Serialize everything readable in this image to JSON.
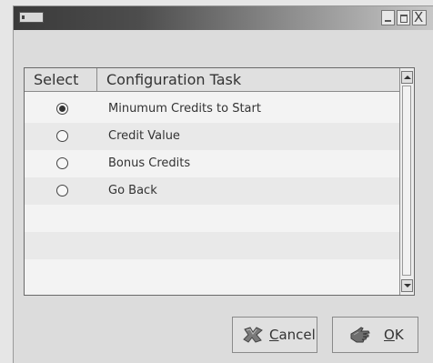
{
  "window": {
    "controls": [
      "minimize-icon",
      "maximize-icon",
      "close-icon"
    ],
    "close_glyph": "X"
  },
  "table": {
    "headers": {
      "select": "Select",
      "task": "Configuration Task"
    },
    "rows": [
      {
        "label": "Minumum Credits to Start",
        "selected": true
      },
      {
        "label": "Credit Value",
        "selected": false
      },
      {
        "label": "Bonus Credits",
        "selected": false
      },
      {
        "label": "Go Back",
        "selected": false
      }
    ]
  },
  "buttons": {
    "cancel": "Cancel",
    "ok": "OK"
  },
  "icons": {
    "cancel": "cancel-icon",
    "ok": "hand-pointing-icon"
  }
}
